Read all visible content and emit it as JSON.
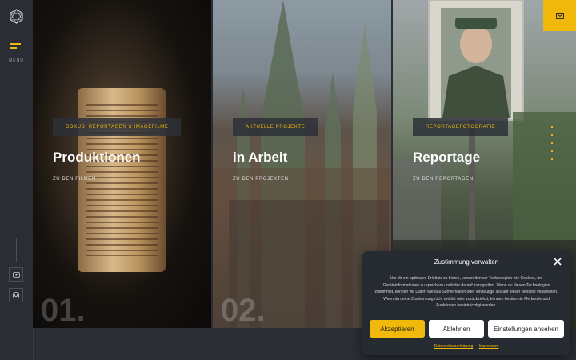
{
  "sidebar": {
    "logo_icon": "geometric-logo-icon",
    "menu_label": "MENU",
    "social": [
      {
        "icon": "youtube-icon"
      },
      {
        "icon": "instagram-icon"
      }
    ]
  },
  "header": {
    "contact_icon": "mail-icon",
    "accent": "#f0b90b"
  },
  "panels": [
    {
      "tag": "DOKUS, REPORTAGEN & IMAGEFILME",
      "title": "Produktionen",
      "link": "ZU DEN FILMEN",
      "number": "01."
    },
    {
      "tag": "AKTUELLE PROJEKTE",
      "title": "in Arbeit",
      "link": "ZU DEN PROJEKTEN",
      "number": "02."
    },
    {
      "tag": "REPORTAGEFOTOGRAFIE",
      "title": "Reportage",
      "link": "ZU DEN REPORTAGEN",
      "number": ""
    }
  ],
  "consent": {
    "title": "Zustimmung verwalten",
    "text": "Um dir ein optimales Erlebnis zu bieten, verwenden wir Technologien wie Cookies, um Geräteinformationen zu speichern und/oder darauf zuzugreifen. Wenn du diesen Technologien zustimmst, können wir Daten wie das Surfverhalten oder eindeutige IDs auf dieser Website verarbeiten. Wenn du deine Zustimmung nicht erteilst oder zurückziehst, können bestimmte Merkmale und Funktionen beeinträchtigt werden.",
    "accept": "Akzeptieren",
    "deny": "Ablehnen",
    "settings": "Einstellungen ansehen",
    "privacy": "Datenschutzerklärung",
    "imprint": "Impressum"
  }
}
